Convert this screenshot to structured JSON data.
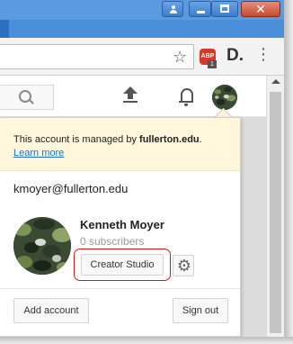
{
  "window": {
    "close_glyph": "✕"
  },
  "toolbar": {
    "star_glyph": "☆",
    "abp_label": "ABP",
    "abp_badge": "1",
    "d_label": "D.",
    "menu_glyph": "⋮"
  },
  "panel": {
    "notice_prefix": "This account is managed by ",
    "notice_domain": "fullerton.edu",
    "notice_suffix": ".",
    "learn_more": "Learn more",
    "email": "kmoyer@fullerton.edu",
    "name": "Kenneth Moyer",
    "subscribers": "0 subscribers",
    "creator_studio": "Creator Studio",
    "gear_glyph": "⚙",
    "add_account": "Add account",
    "sign_out": "Sign out"
  },
  "colors": {
    "accent_link": "#1a73c9",
    "notice_bg": "#fff6dc",
    "highlight": "#d21a1a",
    "close_button": "#c64a2f"
  }
}
